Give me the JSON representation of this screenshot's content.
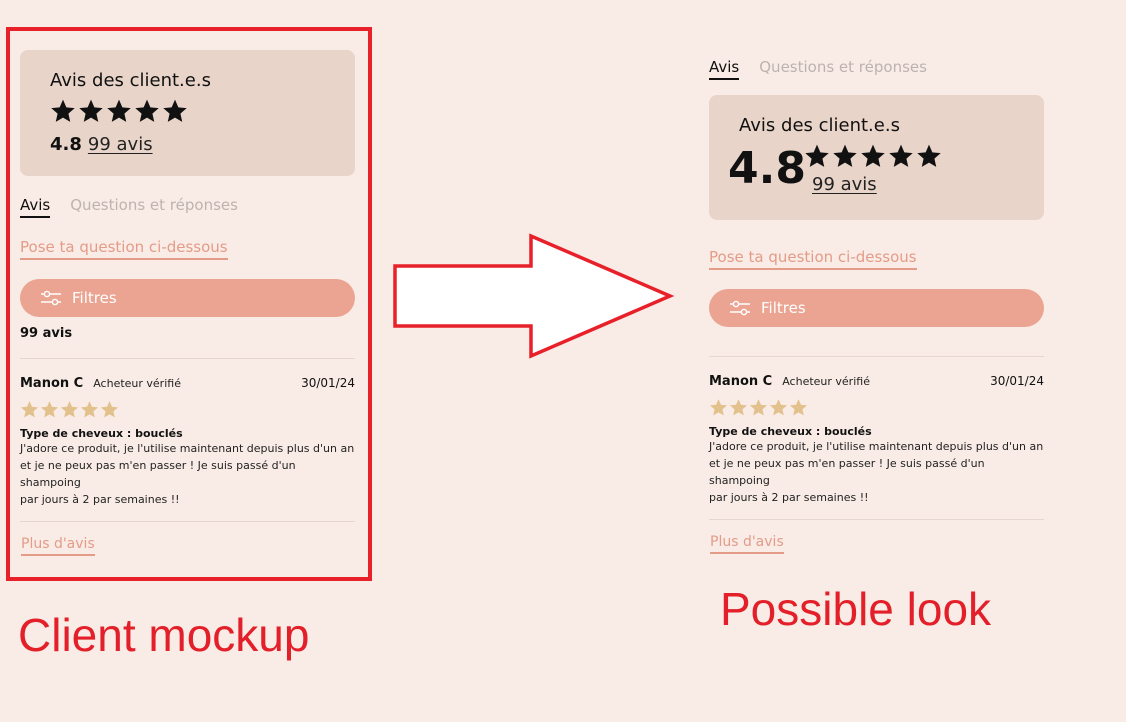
{
  "mockup": {
    "summary_title": "Avis des client.e.s",
    "rating": "4.8",
    "review_count_link": "99 avis",
    "tab_reviews": "Avis",
    "tab_qa": "Questions et réponses",
    "ask_link": "Pose ta question ci-dessous",
    "filter_label": "Filtres",
    "count_text": "99 avis",
    "review": {
      "name": "Manon C",
      "verified": "Acheteur vérifié",
      "date": "30/01/24",
      "stars": 5,
      "hair_type": "Type de cheveux : bouclés",
      "body_line1": "J'adore ce produit, je l'utilise maintenant depuis plus d'un an",
      "body_line2": "et je ne peux pas m'en passer ! Je suis passé d'un shampoing",
      "body_line3": "par jours à 2 par semaines !!"
    },
    "more_link": "Plus d'avis",
    "caption": "Client mockup"
  },
  "proposal": {
    "tab_reviews": "Avis",
    "tab_qa": "Questions et réponses",
    "summary_title": "Avis des client.e.s",
    "rating": "4.8",
    "review_count_link": "99 avis",
    "ask_link": "Pose ta question ci-dessous",
    "filter_label": "Filtres",
    "review": {
      "name": "Manon C",
      "verified": "Acheteur vérifié",
      "date": "30/01/24",
      "stars": 5,
      "hair_type": "Type de cheveux : bouclés",
      "body_line1": "J'adore ce produit, je l'utilise maintenant depuis plus d'un an",
      "body_line2": "et je ne peux pas m'en passer ! Je suis passé d'un shampoing",
      "body_line3": "par jours à 2 par semaines !!"
    },
    "more_link": "Plus d'avis",
    "caption": "Possible look"
  },
  "colors": {
    "background": "#f9ece6",
    "card": "#e8d4c9",
    "accent": "#eba491",
    "link": "#e49b87",
    "gold_star": "#e3c18d",
    "annotation_red": "#e8202a"
  },
  "icons": {
    "filter": "sliders-icon",
    "rating_star": "star-icon",
    "arrow": "right-arrow-icon"
  }
}
